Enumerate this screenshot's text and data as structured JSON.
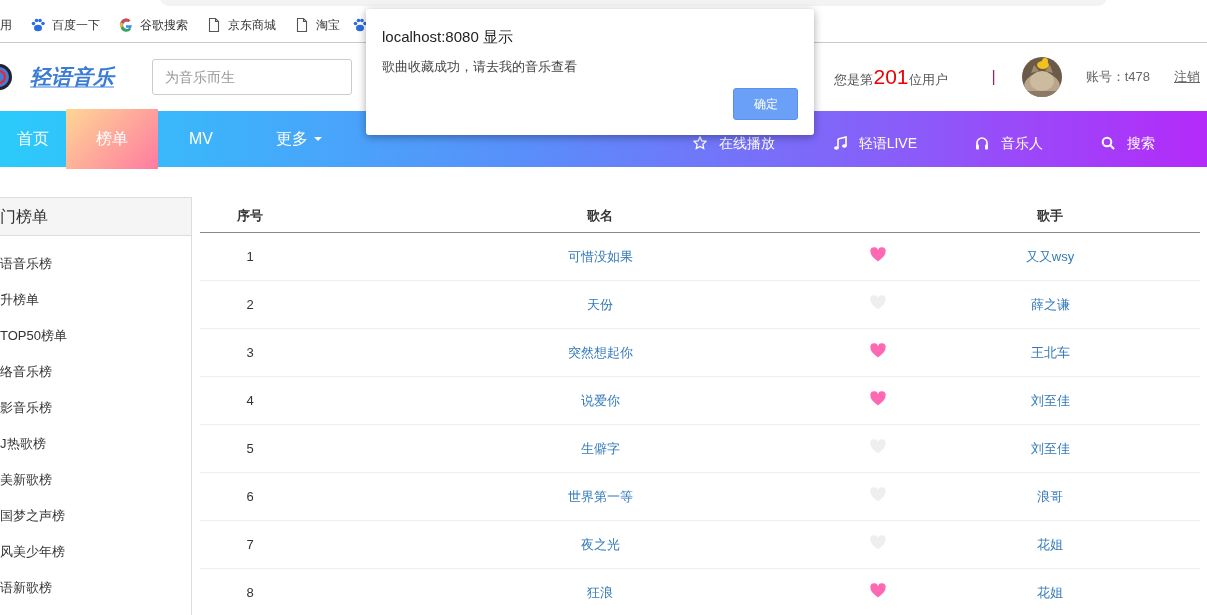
{
  "browser": {
    "bookmarks": [
      {
        "label": "用",
        "kind": "none"
      },
      {
        "label": "百度一下",
        "kind": "paw"
      },
      {
        "label": "谷歌搜索",
        "kind": "google"
      },
      {
        "label": "京东商城",
        "kind": "page"
      },
      {
        "label": "淘宝",
        "kind": "page"
      },
      {
        "kind": "paw"
      }
    ]
  },
  "header": {
    "logo_text": "轻语音乐",
    "search": {
      "placeholder": "为音乐而生"
    },
    "user_count_prefix": "您是第",
    "user_count": "201",
    "user_count_suffix": "位用户",
    "separator": "|",
    "account": "账号：t478",
    "logout": "注销"
  },
  "nav": {
    "left": [
      {
        "label": "首页",
        "selected": false,
        "dropdown": false
      },
      {
        "label": "榜单",
        "selected": true,
        "dropdown": false
      },
      {
        "label": "MV",
        "selected": false,
        "dropdown": false
      },
      {
        "label": "更多",
        "selected": false,
        "dropdown": true
      }
    ],
    "right": [
      {
        "label": "在线播放"
      },
      {
        "label": "轻语LIVE"
      },
      {
        "label": "音乐人"
      },
      {
        "label": "搜索"
      }
    ]
  },
  "sidebar": {
    "title": "门榜单",
    "items": [
      "语音乐榜",
      "升榜单",
      "TOP50榜单",
      "络音乐榜",
      "影音乐榜",
      "J热歌榜",
      "美新歌榜",
      "国梦之声榜",
      "风美少年榜",
      "语新歌榜"
    ]
  },
  "table": {
    "columns": [
      "序号",
      "歌名",
      "歌手"
    ],
    "rows": [
      {
        "number": "1",
        "title": "可惜没如果",
        "favorited": true,
        "artist": "又又wsy"
      },
      {
        "number": "2",
        "title": "天份",
        "favorited": false,
        "artist": "薛之谦"
      },
      {
        "number": "3",
        "title": "突然想起你",
        "favorited": true,
        "artist": "王北车"
      },
      {
        "number": "4",
        "title": "说爱你",
        "favorited": true,
        "artist": "刘至佳"
      },
      {
        "number": "5",
        "title": "生僻字",
        "favorited": false,
        "artist": "刘至佳"
      },
      {
        "number": "6",
        "title": "世界第一等",
        "favorited": false,
        "artist": "浪哥"
      },
      {
        "number": "7",
        "title": "夜之光",
        "favorited": false,
        "artist": "花姐"
      },
      {
        "number": "8",
        "title": "狂浪",
        "favorited": true,
        "artist": "花姐"
      }
    ]
  },
  "dialog": {
    "title": "localhost:8080 显示",
    "message": "歌曲收藏成功，请去我的音乐查看",
    "ok": "确定"
  }
}
